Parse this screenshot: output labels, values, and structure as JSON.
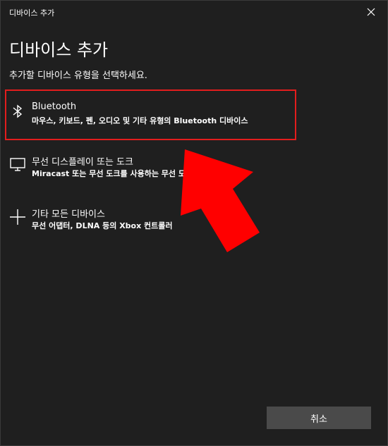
{
  "window": {
    "title": "디바이스 추가"
  },
  "page": {
    "heading": "디바이스 추가",
    "subtitle": "추가할 디바이스 유형을 선택하세요."
  },
  "options": [
    {
      "icon": "bluetooth-icon",
      "title": "Bluetooth",
      "desc": "마우스, 키보드, 펜, 오디오 및 기타 유형의 Bluetooth 디바이스",
      "selected": true
    },
    {
      "icon": "monitor-icon",
      "title": "무선 디스플레이 또는 도크",
      "desc": "Miracast 또는 무선 도크를 사용하는 무선 모니터, TV 또는 PC"
    },
    {
      "icon": "plus-icon",
      "title": "기타 모든 디바이스",
      "desc": "무선 어댑터, DLNA 등의 Xbox 컨트롤러"
    }
  ],
  "footer": {
    "cancel_label": "취소"
  },
  "colors": {
    "background": "#1f1f1f",
    "highlight": "#e31d1d",
    "button": "#4a4a4a",
    "arrow": "#ff0000"
  }
}
